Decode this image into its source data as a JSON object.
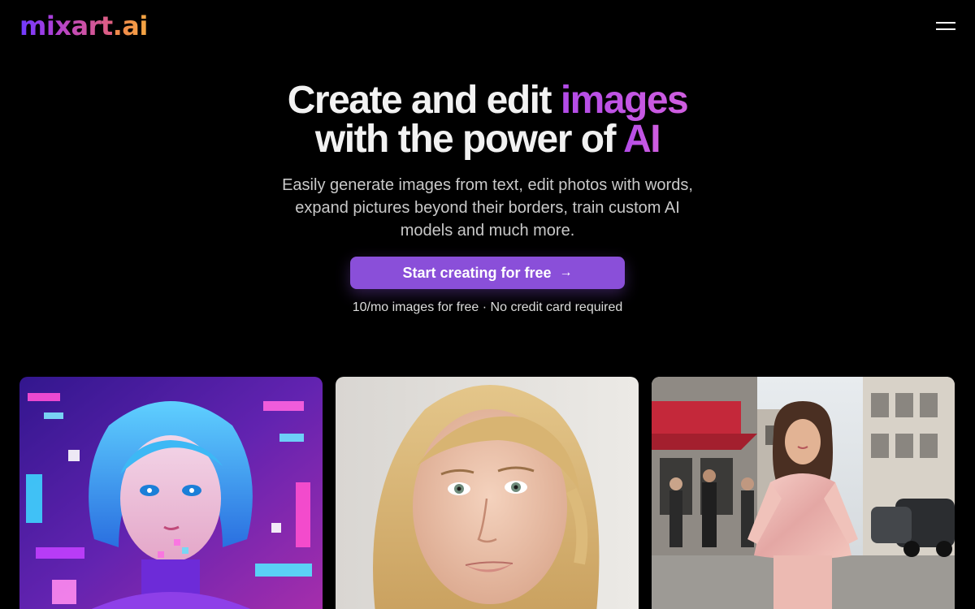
{
  "header": {
    "logo": {
      "mix": "mix",
      "art": "art",
      "dot": ".",
      "ai": "ai"
    },
    "menu_icon": "hamburger-menu-icon"
  },
  "hero": {
    "headline_line1": "Create and edit ",
    "headline_accent1": "images",
    "headline_line2": "with the power of ",
    "headline_accent2": "AI",
    "subtitle": "Easily generate images from text, edit photos with words, expand pictures beyond their borders, train custom AI models and much more.",
    "cta_label": "Start creating for free",
    "cta_icon": "arrow-right-icon",
    "note": "10/mo images for free · No credit card required"
  },
  "colors": {
    "background": "#000000",
    "accent": "#8a4fd9",
    "headline_accent": "#c456e4"
  },
  "gallery": {
    "images": [
      {
        "name": "anime-glitch-portrait"
      },
      {
        "name": "blonde-woman-portrait"
      },
      {
        "name": "street-fashion-woman"
      }
    ]
  }
}
